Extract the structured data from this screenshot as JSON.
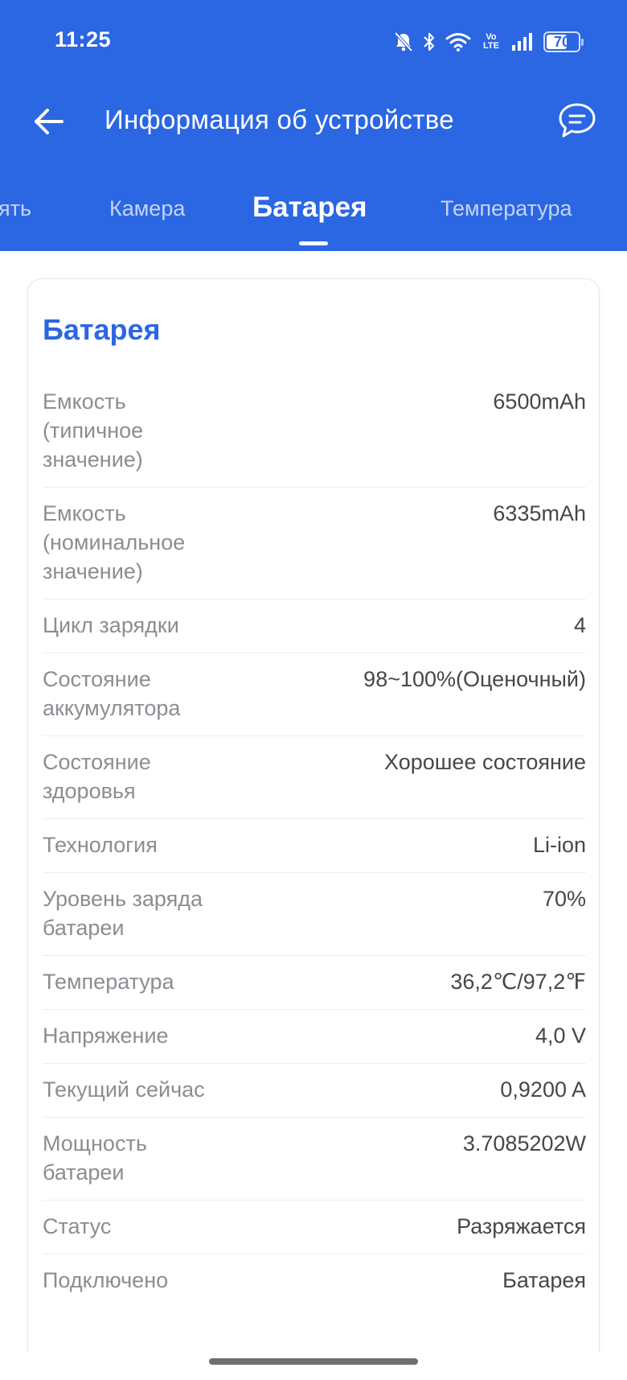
{
  "status_bar": {
    "time": "11:25",
    "battery_percent": 70,
    "battery_label": "70",
    "volte_top": "Vo",
    "volte_bottom": "LTE",
    "icons": [
      "bell-muted-icon",
      "bluetooth-icon",
      "wifi-icon",
      "volte-icon",
      "signal-icon",
      "battery-icon"
    ]
  },
  "app_bar": {
    "title": "Информация об устройстве",
    "back_icon": "arrow-left-icon",
    "feedback_icon": "chat-bubble-icon"
  },
  "tabs": [
    {
      "label": "ять",
      "active": false
    },
    {
      "label": "Камера",
      "active": false
    },
    {
      "label": "Батарея",
      "active": true
    },
    {
      "label": "Температура",
      "active": false
    }
  ],
  "card": {
    "title": "Батарея",
    "rows": [
      {
        "label": "Емкость (типичное значение)",
        "value": "6500mAh"
      },
      {
        "label": "Емкость (номинальное значение)",
        "value": "6335mAh"
      },
      {
        "label": "Цикл зарядки",
        "value": "4"
      },
      {
        "label": "Состояние аккумулятора",
        "value": "98~100%(Оценочный)"
      },
      {
        "label": "Состояние здоровья",
        "value": "Хорошее состояние"
      },
      {
        "label": "Технология",
        "value": "Li-ion"
      },
      {
        "label": "Уровень заряда батареи",
        "value": "70%"
      },
      {
        "label": "Температура",
        "value": "36,2℃/97,2℉"
      },
      {
        "label": "Напряжение",
        "value": "4,0 V"
      },
      {
        "label": "Текущий сейчас",
        "value": "0,9200 A"
      },
      {
        "label": "Мощность батареи",
        "value": "3.7085202W"
      },
      {
        "label": "Статус",
        "value": "Разряжается"
      },
      {
        "label": "Подключено",
        "value": "Батарея"
      }
    ]
  },
  "colors": {
    "accent": "#2B66E3",
    "label": "#8B8D92",
    "value": "#45474B"
  }
}
